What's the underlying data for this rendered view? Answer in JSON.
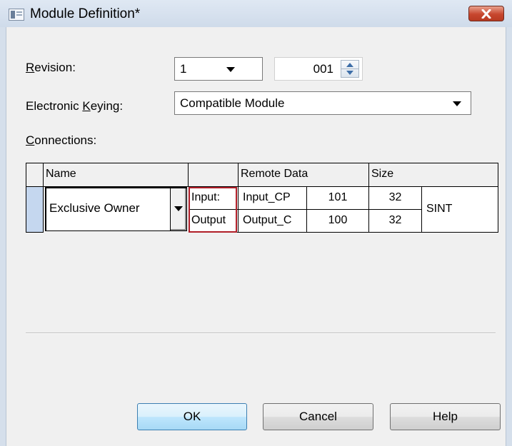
{
  "window": {
    "title": "Module Definition*"
  },
  "revision": {
    "label_u": "R",
    "label_rest": "evision:",
    "major_value": "1",
    "minor_value": "001"
  },
  "keying": {
    "label_pre": "Electronic ",
    "label_u": "K",
    "label_rest": "eying:",
    "value": "Compatible Module"
  },
  "connections": {
    "label_u": "C",
    "label_rest": "onnections:",
    "headers": {
      "name": "Name",
      "direction": "",
      "remote_data": "Remote Data",
      "size": "Size"
    },
    "row": {
      "name": "Exclusive Owner",
      "input": {
        "direction": "Input:",
        "tag": "Input_CP",
        "instance": "101",
        "size": "32"
      },
      "output": {
        "direction": "Output",
        "tag": "Output_C",
        "instance": "100",
        "size": "32"
      },
      "type": "SINT"
    }
  },
  "buttons": {
    "ok": "OK",
    "cancel": "Cancel",
    "help": "Help"
  },
  "colors": {
    "highlight": "#b01e28",
    "default_button": "#3c7fb1",
    "row_selector": "#c5d7ef"
  }
}
